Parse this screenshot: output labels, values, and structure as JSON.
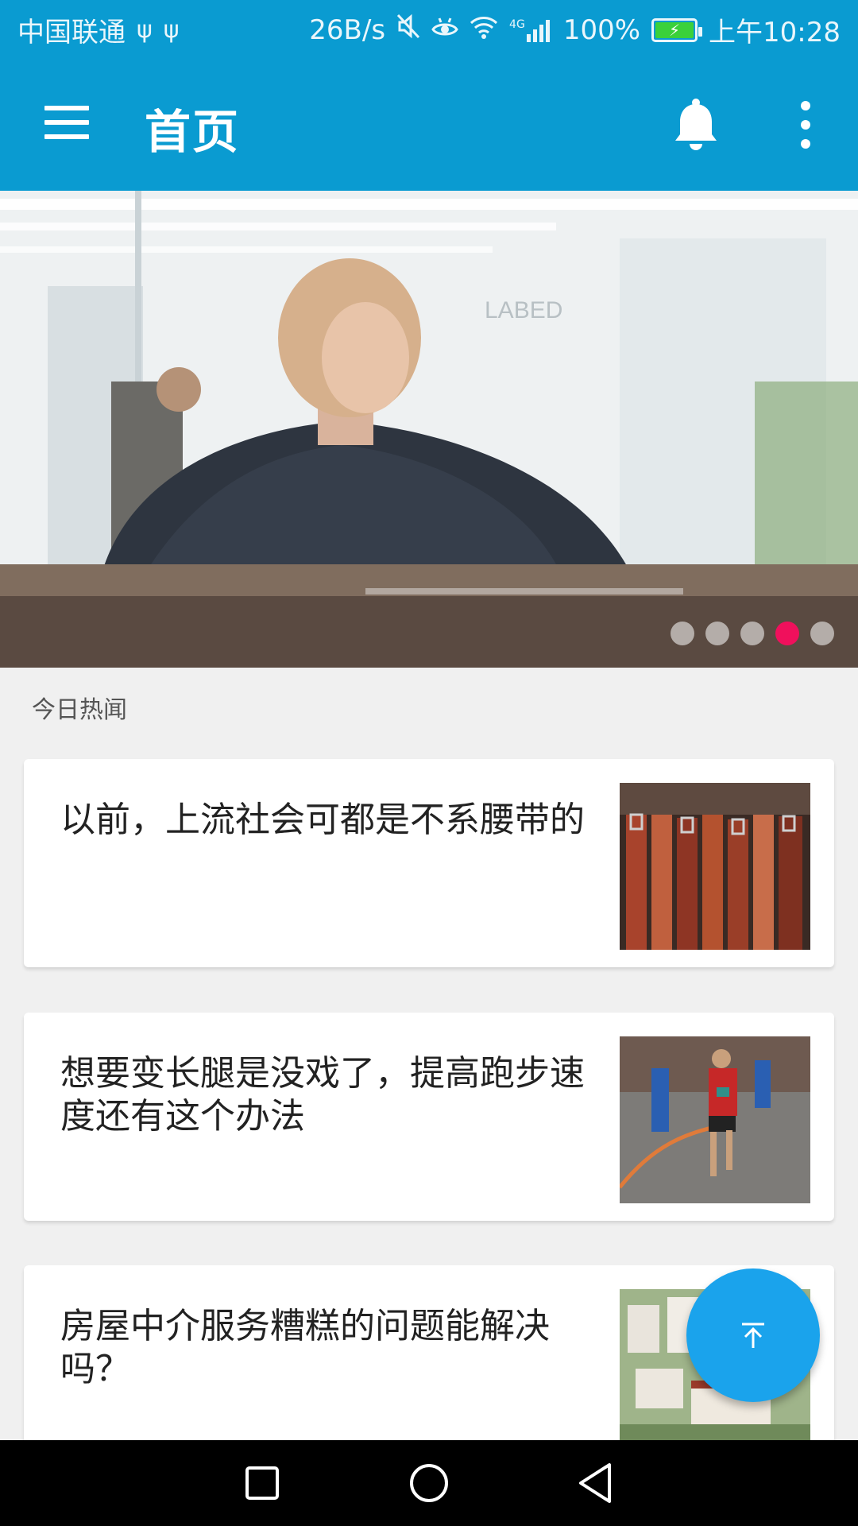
{
  "status_bar": {
    "carrier": "中国联通",
    "usb_icons": [
      "usb-icon",
      "usb-icon"
    ],
    "net_speed": "26B/s",
    "icons": [
      "mute-icon",
      "eye-comfort-icon",
      "wifi-icon",
      "4g-signal-icon"
    ],
    "network_type": "4G",
    "battery_percent": "100%",
    "battery_level": 1.0,
    "time": "上午10:28"
  },
  "app_bar": {
    "title": "首页",
    "background_color": "#0a9bd1",
    "menu_icon": "menu-icon",
    "notification_icon": "bell-icon",
    "overflow_icon": "more-vert-icon"
  },
  "banner": {
    "image_label": "LABED",
    "dots_count": 5,
    "active_dot_index": 3,
    "active_dot_color": "#f0105c"
  },
  "section": {
    "label": "今日热闻"
  },
  "news": [
    {
      "title": "以前，上流社会可都是不系腰带的",
      "thumb": "leather-belts"
    },
    {
      "title": "想要变长腿是没戏了，提高跑步速度还有这个办法",
      "thumb": "marathon-runner"
    },
    {
      "title": "房屋中介服务糟糕的问题能解决吗？",
      "thumb": "housing-model"
    }
  ],
  "fab": {
    "icon": "arrow-to-top-icon",
    "color": "#1aa3ec"
  },
  "nav_bar": {
    "buttons": [
      "recent-apps-icon",
      "home-icon",
      "back-icon"
    ]
  }
}
